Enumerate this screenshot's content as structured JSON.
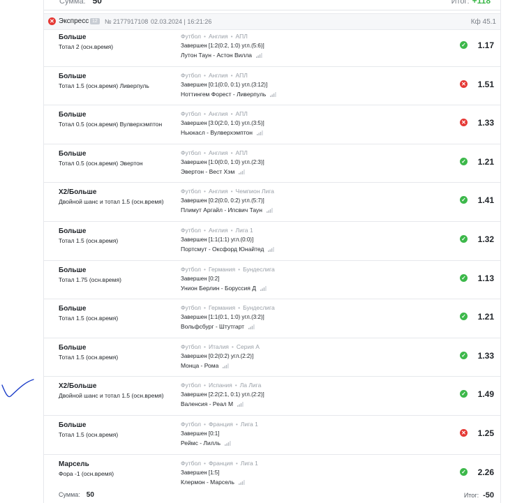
{
  "previous_slip": {
    "sum_label": "Сумма:",
    "sum_value": "50",
    "total_label": "Итог:",
    "total_value": "+118"
  },
  "slip": {
    "status_icon": "close-icon",
    "type": "Экспресс",
    "badge": "12",
    "number": "№ 2177917108",
    "datetime": "02.03.2024 | 16:21:26",
    "coefficient": "Кф 45.1",
    "bets": [
      {
        "market": "Больше",
        "selection": "Тотал 2 (осн.время)",
        "sport": "Футбол",
        "country": "Англия",
        "league": "АПЛ",
        "status": "Завершен [1:2(0:2, 1:0) угл.(5:6)]",
        "teams": "Лутон Таун - Астон Вилла",
        "result": "won",
        "odds": "1.17"
      },
      {
        "market": "Больше",
        "selection": "Тотал 1.5 (осн.время) Ливерпуль",
        "sport": "Футбол",
        "country": "Англия",
        "league": "АПЛ",
        "status": "Завершен [0:1(0:0, 0:1) угл.(3:12)]",
        "teams": "Ноттингем Форест - Ливерпуль",
        "result": "lost",
        "odds": "1.51"
      },
      {
        "market": "Больше",
        "selection": "Тотал 0.5 (осн.время) Вулверхэмптон",
        "sport": "Футбол",
        "country": "Англия",
        "league": "АПЛ",
        "status": "Завершен [3:0(2:0, 1:0) угл.(3:5)]",
        "teams": "Ньюкасл - Вулверхэмптон",
        "result": "lost",
        "odds": "1.33"
      },
      {
        "market": "Больше",
        "selection": "Тотал 0.5 (осн.время) Эвертон",
        "sport": "Футбол",
        "country": "Англия",
        "league": "АПЛ",
        "status": "Завершен [1:0(0:0, 1:0) угл.(2:3)]",
        "teams": "Эвертон - Вест Хэм",
        "result": "won",
        "odds": "1.21"
      },
      {
        "market": "X2/Больше",
        "selection": "Двойной шанс и тотал 1.5 (осн.время)",
        "sport": "Футбол",
        "country": "Англия",
        "league": "Чемпион Лига",
        "status": "Завершен [0:2(0:0, 0:2) угл.(5:7)]",
        "teams": "Плимут Аргайл - Ипсвич Таун",
        "result": "won",
        "odds": "1.41"
      },
      {
        "market": "Больше",
        "selection": "Тотал 1.5 (осн.время)",
        "sport": "Футбол",
        "country": "Англия",
        "league": "Лига 1",
        "status": "Завершен [1:1(1:1) угл.(0:0)]",
        "teams": "Портсмут - Оксфорд Юнайтед",
        "result": "won",
        "odds": "1.32"
      },
      {
        "market": "Больше",
        "selection": "Тотал 1.75 (осн.время)",
        "sport": "Футбол",
        "country": "Германия",
        "league": "Бундеслига",
        "status": "Завершен [0:2]",
        "teams": "Унион Берлин - Боруссия Д",
        "result": "won",
        "odds": "1.13"
      },
      {
        "market": "Больше",
        "selection": "Тотал 1.5 (осн.время)",
        "sport": "Футбол",
        "country": "Германия",
        "league": "Бундеслига",
        "status": "Завершен [1:1(0:1, 1:0) угл.(3:2)]",
        "teams": "Вольфсбург - Штутгарт",
        "result": "won",
        "odds": "1.21"
      },
      {
        "market": "Больше",
        "selection": "Тотал 1.5 (осн.время)",
        "sport": "Футбол",
        "country": "Италия",
        "league": "Серия А",
        "status": "Завершен [0:2(0:2) угл.(2:2)]",
        "teams": "Монца - Рома",
        "result": "won",
        "odds": "1.33"
      },
      {
        "market": "X2/Больше",
        "selection": "Двойной шанс и тотал 1.5 (осн.время)",
        "sport": "Футбол",
        "country": "Испания",
        "league": "Ла Лига",
        "status": "Завершен [2:2(2:1, 0:1) угл.(2:2)]",
        "teams": "Валенсия - Реал М",
        "result": "won",
        "odds": "1.49"
      },
      {
        "market": "Больше",
        "selection": "Тотал 1.5 (осн.время)",
        "sport": "Футбол",
        "country": "Франция",
        "league": "Лига 1",
        "status": "Завершен [0:1]",
        "teams": "Реймс - Лилль",
        "result": "lost",
        "odds": "1.25"
      },
      {
        "market": "Марсель",
        "selection": "Фора -1 (осн.время)",
        "sport": "Футбол",
        "country": "Франция",
        "league": "Лига 1",
        "status": "Завершен [1:5]",
        "teams": "Клермон - Марсель",
        "result": "won",
        "odds": "2.26"
      }
    ],
    "sum_label": "Сумма:",
    "sum_value": "50",
    "total_label": "Итог:",
    "total_value": "-50"
  },
  "colors": {
    "won": "#3cb84a",
    "lost": "#e53935",
    "muted": "#9aa0a8",
    "text": "#1f2328",
    "handmark": "#1a3cc8"
  },
  "icons": {
    "won": "check-circle-icon",
    "lost": "close-circle-icon",
    "stats": "stats-bars-icon",
    "handmark": "handwritten-checkmark"
  }
}
